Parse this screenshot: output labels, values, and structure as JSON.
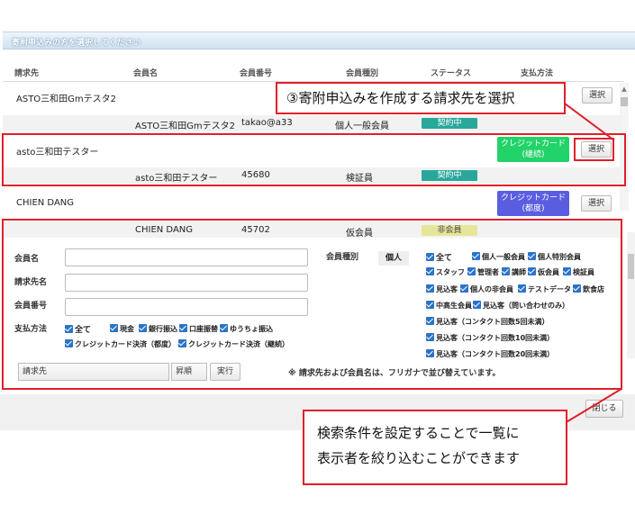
{
  "dialog": {
    "title": "寄附申込みの方を選択してください",
    "close_label": "閉じる"
  },
  "columns": {
    "billing": "請求先",
    "member_name": "会員名",
    "member_no": "会員番号",
    "member_type": "会員種別",
    "status": "ステータス",
    "payment": "支払方法"
  },
  "rows": [
    {
      "billing": "ASTO三和田Gmテスタ2",
      "member_name": "ASTO三和田Gmテスタ2",
      "member_no": "takao@a33",
      "member_type": "個人一般会員",
      "status": "契約中",
      "payment": "",
      "select_label": "選択"
    },
    {
      "billing": "asto三和田テスター",
      "member_name": "asto三和田テスター",
      "member_no": "45680",
      "member_type": "検証員",
      "status": "契約中",
      "payment_line1": "クレジットカード",
      "payment_line2": "(継続)",
      "select_label": "選択"
    },
    {
      "billing": "CHIEN DANG",
      "member_name": "CHIEN DANG",
      "member_no": "45702",
      "member_type": "仮会員",
      "status": "非会員",
      "payment_line1": "クレジットカード",
      "payment_line2": "(都度)",
      "select_label": "選択"
    }
  ],
  "search": {
    "member_name_label": "会員名",
    "billing_name_label": "請求先名",
    "member_no_label": "会員番号",
    "payment_label": "支払方法",
    "payment_options": [
      "全て",
      "現金",
      "銀行振込",
      "口座振替",
      "ゆうちょ振込",
      "クレジットカード決済（都度）",
      "クレジットカード決済（継続）"
    ],
    "member_type_label": "会員種別",
    "kojin_label": "個人",
    "type_options_row1": [
      "全て",
      "個人一般会員",
      "個人特別会員"
    ],
    "type_options_row2": [
      "スタッフ",
      "管理者",
      "講師",
      "仮会員",
      "検証員"
    ],
    "type_options_row3": [
      "見込客",
      "個人の非会員",
      "テストデータ",
      "飲食店"
    ],
    "type_options_row4": [
      "中高生会員",
      "見込客（問い合わせのみ）"
    ],
    "type_options_row5": [
      "見込客（コンタクト回数5回未満）"
    ],
    "type_options_row6": [
      "見込客（コンタクト回数10回未満）"
    ],
    "type_options_row7": [
      "見込客（コンタクト回数20回未満）"
    ],
    "sort_field": "請求先",
    "sort_order": "昇順",
    "execute_label": "実行",
    "note": "※ 請求先および会員名は、フリガナで並び替えています。"
  },
  "annotations": {
    "callout1": "③寄附申込みを作成する請求先を選択",
    "callout2_line1": "検索条件を設定することで一覧に",
    "callout2_line2": "表示者を絞り込むことができます"
  },
  "colors": {
    "status_active": "#2aa79b",
    "status_nonmember": "#e6e69a",
    "card_continuous": "#22d36a",
    "card_once": "#5b5de0",
    "annotation_red": "#e0202a"
  }
}
